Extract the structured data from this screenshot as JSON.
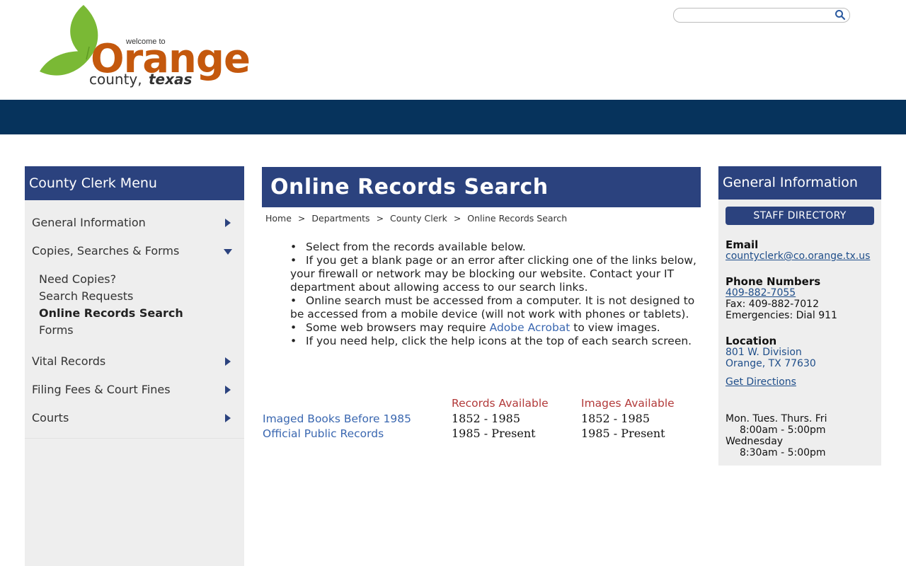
{
  "header": {
    "logo": {
      "small_text": "welcome to",
      "big_text": "Orange",
      "line2_a": "county,",
      "line2_b": "texas"
    },
    "search": {
      "placeholder": "",
      "value": "",
      "icon": "search-icon"
    }
  },
  "left_menu": {
    "title": "County Clerk Menu",
    "items": [
      {
        "label": "General Information",
        "state": "collapsed"
      },
      {
        "label": "Copies, Searches & Forms",
        "state": "expanded"
      },
      {
        "label": "Vital Records",
        "state": "collapsed"
      },
      {
        "label": "Filing Fees & Court Fines",
        "state": "collapsed"
      },
      {
        "label": "Courts",
        "state": "collapsed"
      }
    ],
    "subitems": [
      {
        "label": "Need Copies?"
      },
      {
        "label": "Search Requests"
      },
      {
        "label": "Online Records Search",
        "active": true
      },
      {
        "label": "Forms"
      }
    ]
  },
  "main": {
    "title": "Online Records Search",
    "breadcrumb": [
      "Home",
      "Departments",
      "County Clerk",
      "Online Records Search"
    ],
    "breadcrumb_sep": ">",
    "bullets": [
      {
        "text": "Select from the records available below."
      },
      {
        "text": "If you get a blank page or an error after clicking one of the links below, your firewall or network may be blocking our website.  Contact your IT department about allowing access to our search links."
      },
      {
        "text": "Online search must be accessed from a computer.  It is not designed to be accessed from a mobile device (will not work with phones or tablets)."
      },
      {
        "pre": "Some web browsers may require ",
        "link": "Adobe Acrobat",
        "post": " to view images."
      },
      {
        "text": "If you need help, click the help icons at the top of each search screen."
      }
    ],
    "records": {
      "headers": [
        "Records Available",
        "Images Available"
      ],
      "rows": [
        {
          "name": "Imaged Books Before 1985",
          "records": "1852 - 1985",
          "images": "1852 - 1985"
        },
        {
          "name": "Official Public Records",
          "records": "1985 - Present",
          "images": "1985 - Present"
        }
      ]
    }
  },
  "right_panel": {
    "title": "General Information",
    "staff_button": "STAFF DIRECTORY",
    "email_label": "Email",
    "email": "countyclerk@co.orange.tx.us",
    "phone_label": "Phone Numbers",
    "phone": "409-882-7055",
    "fax": "Fax: 409-882-7012",
    "emergencies": "Emergencies: Dial 911",
    "location_label": "Location",
    "address1": "801 W. Division",
    "address2": "Orange, TX 77630",
    "directions": "Get Directions",
    "hours_days1": "Mon. Tues. Thurs. Fri",
    "hours_time1": "8:00am - 5:00pm",
    "hours_days2": "Wednesday",
    "hours_time2": "8:30am - 5:00pm"
  },
  "colors": {
    "navbar": "#06335c",
    "panel_header": "#2b427e",
    "sidebar_bg": "#eeeeee",
    "logo_orange": "#c4580d",
    "logo_green": "#7ab935",
    "link": "#3a67b0",
    "table_header": "#b23a3a"
  }
}
